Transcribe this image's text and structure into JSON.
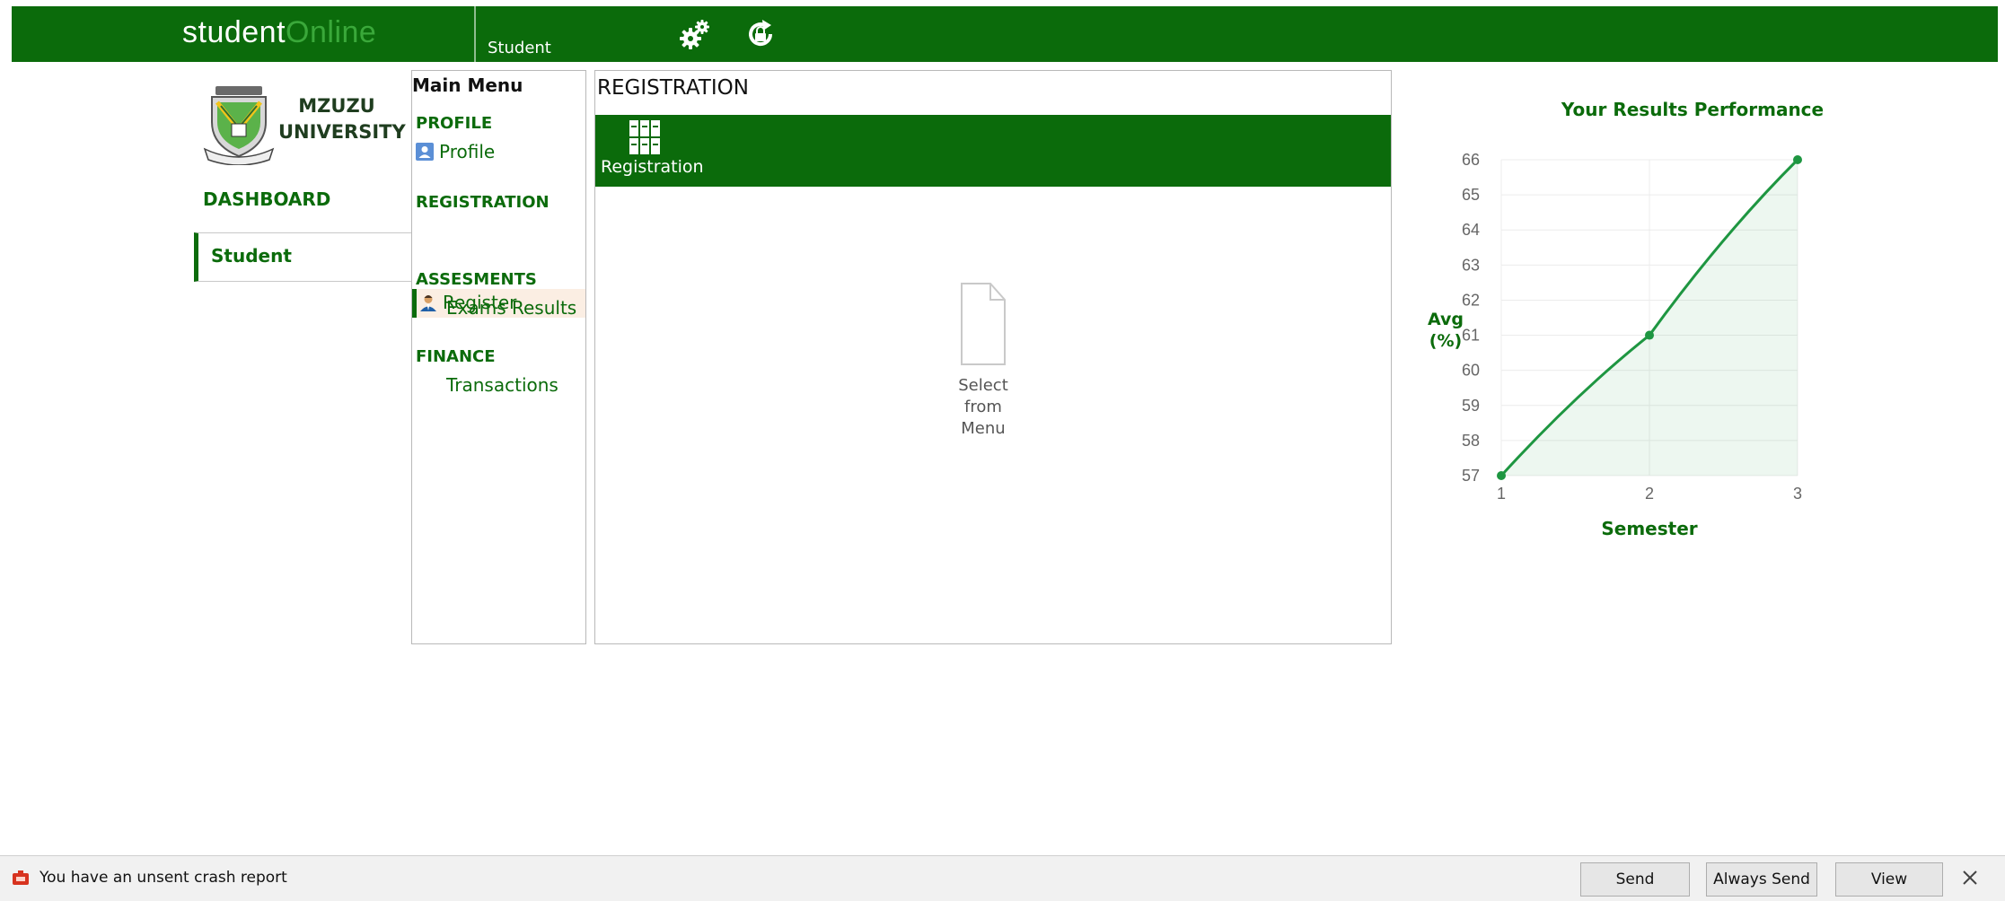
{
  "header": {
    "brand_part1": "student",
    "brand_part2": "Online",
    "role": "Student",
    "icons": [
      "gears-icon",
      "refresh-lock-icon"
    ]
  },
  "sidebar": {
    "logo_line1": "MZUZU",
    "logo_line2": "UNIVERSITY",
    "dashboard": "DASHBOARD",
    "student": "Student"
  },
  "menu": {
    "title": "Main Menu",
    "sections": [
      {
        "heading": "PROFILE",
        "item": "Profile",
        "icon": "user-card-icon"
      },
      {
        "heading": "REGISTRATION",
        "item": "Register",
        "icon": "person-icon",
        "active": true
      },
      {
        "heading": "ASSESMENTS",
        "item": "Exams Results"
      },
      {
        "heading": "FINANCE",
        "item": "Transactions"
      }
    ]
  },
  "registration": {
    "title": "REGISTRATION",
    "tile_label": "Registration",
    "placeholder_line1": "Select",
    "placeholder_line2": "from",
    "placeholder_line3": "Menu"
  },
  "chart_data": {
    "type": "line",
    "title": "Your Results Performance",
    "xlabel": "Semester",
    "ylabel_line1": "Avg",
    "ylabel_line2": "(%)",
    "x": [
      1,
      2,
      3
    ],
    "values": [
      57,
      61,
      66
    ],
    "xticks": [
      1,
      2,
      3
    ],
    "yticks": [
      57,
      58,
      59,
      60,
      61,
      62,
      63,
      64,
      65,
      66
    ],
    "ylim": [
      57,
      66
    ],
    "xlim": [
      1,
      3
    ],
    "grid": true,
    "area_fill": true,
    "color": "#1e9641"
  },
  "crash_bar": {
    "message": "You have an unsent crash report",
    "send": "Send",
    "always_send": "Always Send",
    "view": "View"
  },
  "colors": {
    "brand_green": "#0b6b0b",
    "accent_green": "#3aa83a",
    "chart_green": "#1e9641",
    "active_item_bg": "#fbeee3"
  }
}
